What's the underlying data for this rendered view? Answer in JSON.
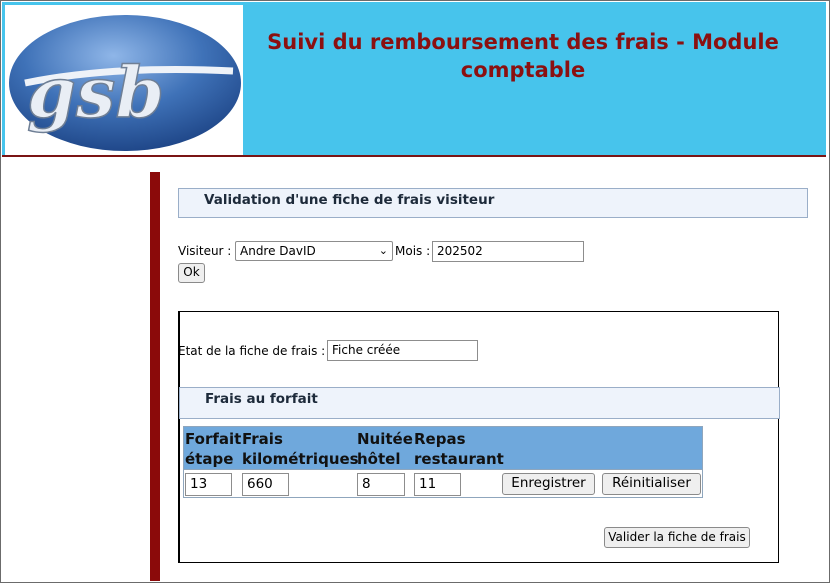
{
  "header": {
    "title": "Suivi du remboursement des frais - Module comptable",
    "logo_text": "gsb"
  },
  "validation": {
    "title": "Validation d'une fiche de frais visiteur",
    "visiteur_label": "Visiteur :",
    "visiteur_selected": "Andre DavID",
    "mois_label": "Mois :",
    "mois_value": "202502",
    "ok_label": "Ok"
  },
  "fiche": {
    "etat_label": "Etat de la fiche de frais :",
    "etat_value": "Fiche créée",
    "forfait_title": "Frais au forfait",
    "columns": [
      "Forfait étape",
      "Frais kilométriques",
      "Nuitée hôtel",
      "Repas restaurant"
    ],
    "values": [
      "13",
      "660",
      "8",
      "11"
    ],
    "save_label": "Enregistrer",
    "reset_label": "Réinitialiser",
    "validate_label": "Valider la fiche de frais"
  },
  "colors": {
    "header_bg": "#47c4ec",
    "title_red": "#8b1010",
    "table_header": "#6fa8dc",
    "accent_bar": "#8b0a0a"
  },
  "icons": [
    "gsb-logo",
    "chevron-down-icon"
  ]
}
